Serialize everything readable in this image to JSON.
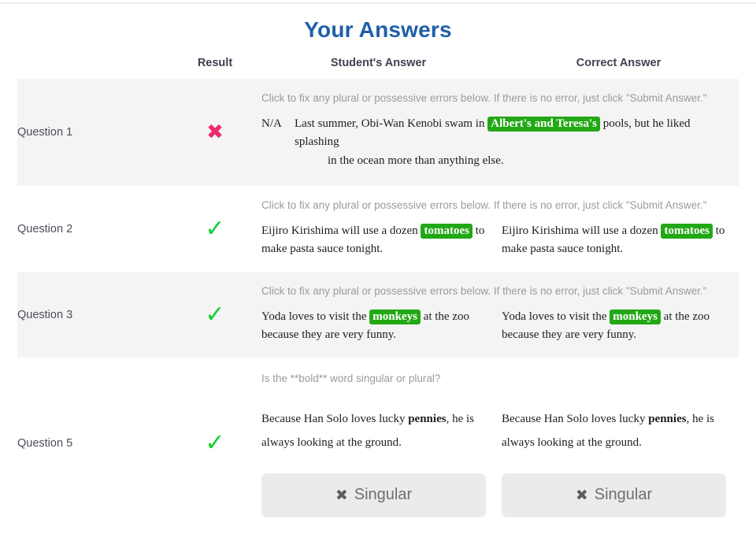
{
  "page": {
    "title": "Your Answers"
  },
  "colors": {
    "title": "#1f5fa9",
    "wrong_mark": "#ee2a6a",
    "right_mark": "#16cf33",
    "highlight": "#22a815",
    "row_shaded": "#f4f4f4",
    "button_bg": "#ebebeb"
  },
  "table": {
    "headers": {
      "question": "",
      "result": "Result",
      "student": "Student's Answer",
      "correct": "Correct Answer"
    },
    "rows": [
      {
        "question_label": "Question 1",
        "result": "wrong",
        "result_icon": "cross-icon",
        "prompt": "Click to fix any plural or possessive errors below. If there is no error, just click \"Submit Answer.\"",
        "student": {
          "na_label": "N/A",
          "text_before": "Last summer, Obi-Wan Kenobi swam in",
          "highlight": "Albert's and Teresa's",
          "text_after": "pools, but he liked splashing",
          "text_line2": "in the ocean more than anything else."
        },
        "correct": null
      },
      {
        "question_label": "Question 2",
        "result": "right",
        "result_icon": "check-icon",
        "prompt": "Click to fix any plural or possessive errors below. If there is no error, just click \"Submit Answer.\"",
        "student": {
          "text_before": "Eijiro Kirishima will use a dozen",
          "highlight": "tomatoes",
          "text_after": "to make pasta sauce tonight."
        },
        "correct": {
          "text_before": "Eijiro Kirishima will use a dozen",
          "highlight": "tomatoes",
          "text_after": "to make pasta sauce tonight."
        }
      },
      {
        "question_label": "Question 3",
        "result": "right",
        "result_icon": "check-icon",
        "prompt": "Click to fix any plural or possessive errors below. If there is no error, just click \"Submit Answer.\"",
        "student": {
          "text_before": "Yoda loves to visit the",
          "highlight": "monkeys",
          "text_after": "at the zoo because they are very funny."
        },
        "correct": {
          "text_before": "Yoda loves to visit the",
          "highlight": "monkeys",
          "text_after": "at the zoo because they are very funny."
        }
      },
      {
        "question_label": "Question 5",
        "result": "right",
        "result_icon": "check-icon",
        "prompt": "Is the **bold** word singular or plural?",
        "student": {
          "text_before": "Because Han Solo loves lucky",
          "bold_word": "pennies",
          "text_after": ", he is always looking at the ground.",
          "button_icon": "cross-icon",
          "button_label": "Singular"
        },
        "correct": {
          "text_before": "Because Han Solo loves lucky",
          "bold_word": "pennies",
          "text_after": ", he is always looking at the ground.",
          "button_icon": "cross-icon",
          "button_label": "Singular"
        }
      }
    ]
  },
  "glyphs": {
    "cross": "✖",
    "check": "✓"
  }
}
